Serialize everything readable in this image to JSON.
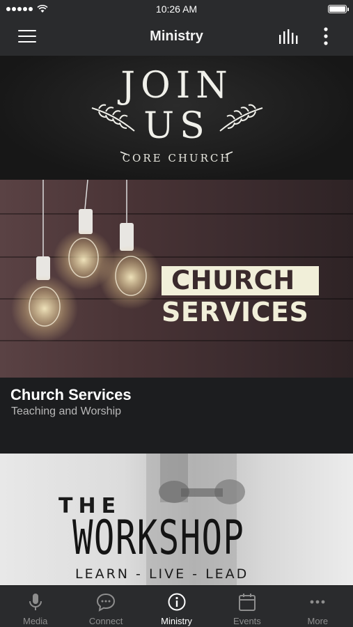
{
  "status_bar": {
    "time": "10:26 AM"
  },
  "nav": {
    "title": "Ministry"
  },
  "banners": {
    "join": {
      "line1": "JOIN",
      "line2": "US",
      "line3": "CORE CHURCH"
    }
  },
  "cards": [
    {
      "image_line1": "CHURCH",
      "image_line2": "SERVICES",
      "title": "Church Services",
      "subtitle": "Teaching and Worship"
    },
    {
      "image_line1": "THE",
      "image_line2": "WORKSHOP",
      "image_line3": "LEARN - LIVE - LEAD"
    }
  ],
  "tabs": [
    {
      "label": "Media",
      "icon": "microphone-icon"
    },
    {
      "label": "Connect",
      "icon": "chat-bubble-icon"
    },
    {
      "label": "Ministry",
      "icon": "info-icon",
      "active": true
    },
    {
      "label": "Events",
      "icon": "calendar-icon"
    },
    {
      "label": "More",
      "icon": "ellipsis-icon"
    }
  ],
  "colors": {
    "bar_bg": "#2a2b2d",
    "content_bg": "#1c1d1f",
    "tab_inactive": "#8e8e8e",
    "tab_active": "#ffffff",
    "services_label_bg": "#f1efd9"
  }
}
